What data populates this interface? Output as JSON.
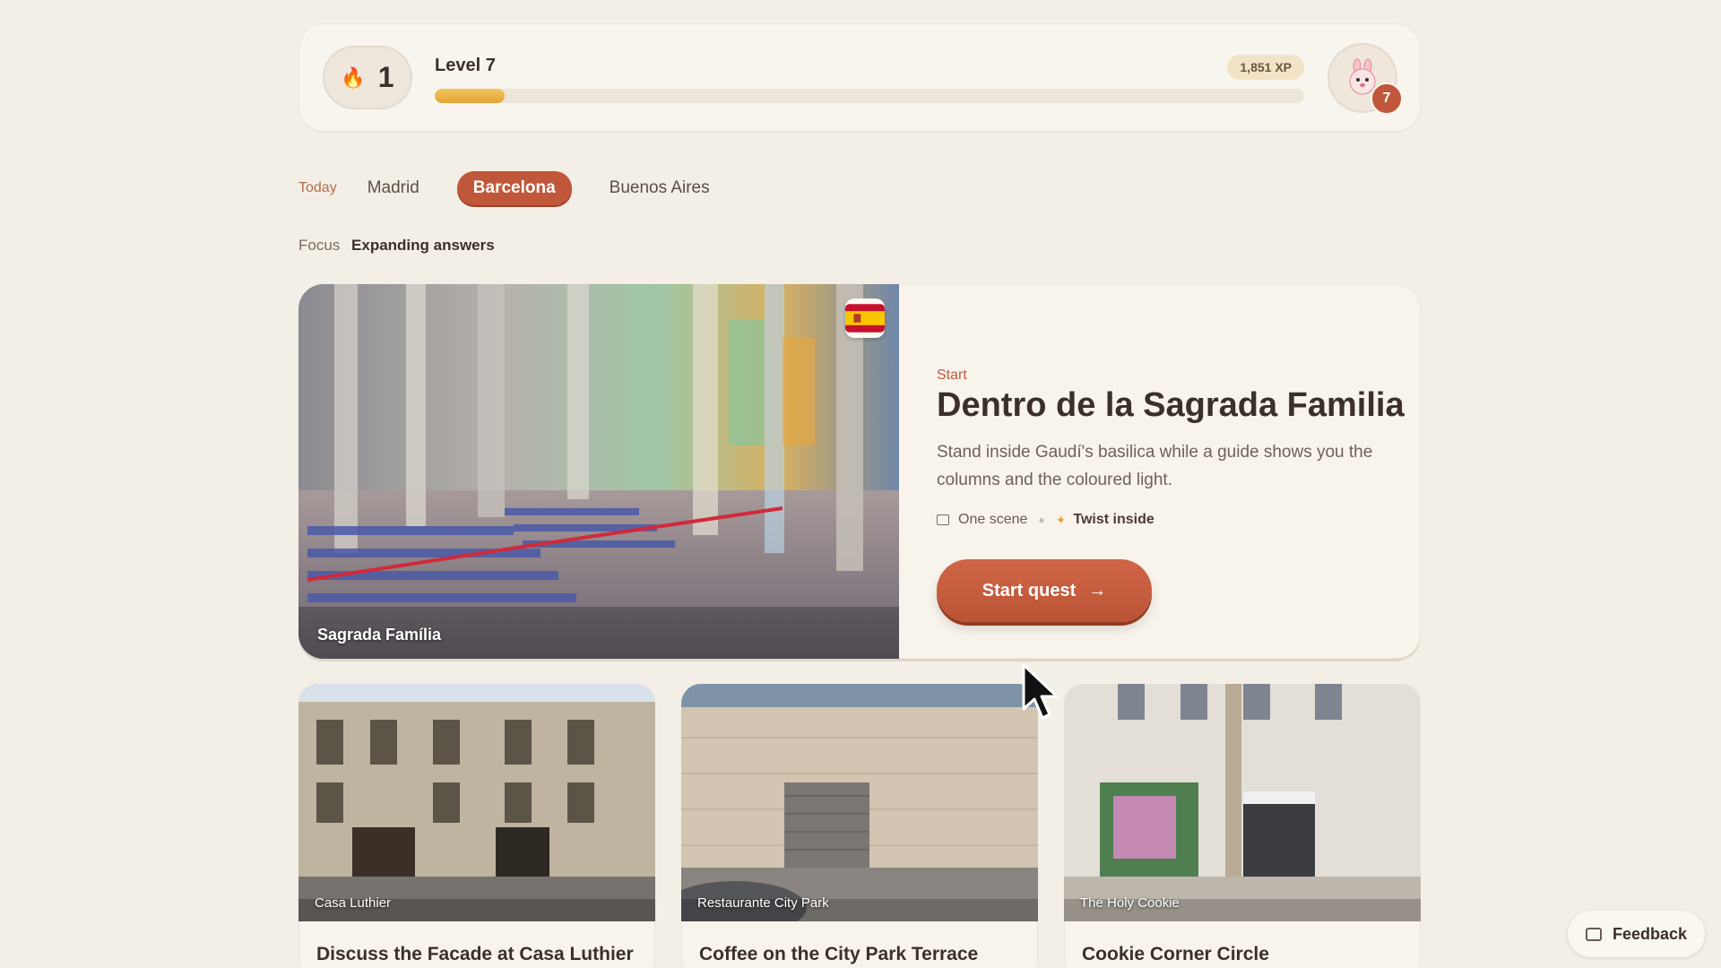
{
  "status": {
    "streak_count": "1",
    "level_label": "Level 7",
    "xp_label": "1,851 XP",
    "progress": 0.08,
    "avatar_level": "7"
  },
  "tabs": {
    "today": "Today",
    "items": [
      "Madrid",
      "Barcelona",
      "Buenos Aires"
    ],
    "active": "Barcelona"
  },
  "focus": {
    "label": "Focus",
    "value": "Expanding answers"
  },
  "hero": {
    "image_caption": "Sagrada Família",
    "eyebrow": "Start",
    "title": "Dentro de la Sagrada Familia",
    "description": "Stand inside Gaudí's basilica while a guide shows you the columns and the coloured light.",
    "meta_scene": "One scene",
    "meta_twist": "Twist inside",
    "button_label": "Start quest"
  },
  "cards": [
    {
      "caption": "Casa Luthier",
      "title": "Discuss the Facade at Casa Luthier"
    },
    {
      "caption": "Restaurante City Park",
      "title": "Coffee on the City Park Terrace"
    },
    {
      "caption": "The Holy Cookie",
      "title": "Cookie Corner Circle"
    }
  ],
  "feedback_label": "Feedback",
  "colors": {
    "accent": "#c0573b",
    "background": "#f3efe6",
    "progress_fill": "#e9b447"
  }
}
